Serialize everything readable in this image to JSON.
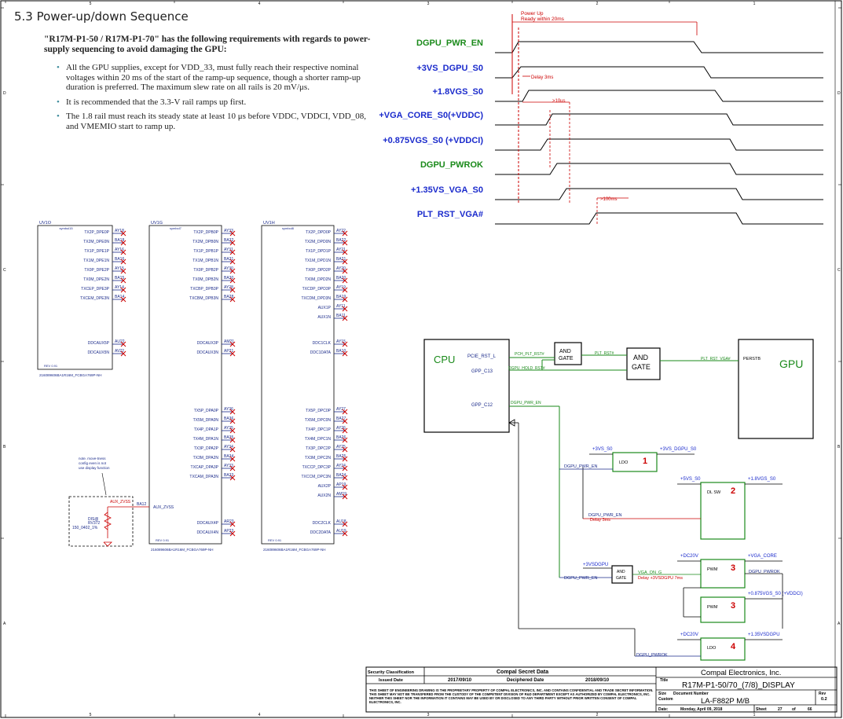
{
  "section": {
    "title": "5.3 Power-up/down Sequence",
    "intro": "\"R17M-P1-50 / R17M-P1-70\" has the following requirements with regards to power-supply sequencing to avoid damaging the GPU:",
    "bullets": [
      "All the GPU supplies, except for VDD_33, must fully reach their respective nominal voltages within 20 ms of the start of the ramp-up sequence, though a shorter ramp-up duration is preferred. The maximum slew rate on all rails is 20 mV/μs.",
      "It is recommended that the 3.3-V rail ramps up first.",
      "The 1.8 rail must reach its steady state at least 10 μs before VDDC, VDDCI, VDD_08, and VMEMIO start to ramp up."
    ]
  },
  "timing": {
    "signals": [
      "DGPU_PWR_EN",
      "+3VS_DGPU_S0",
      "+1.8VGS_S0",
      "+VGA_CORE_S0(+VDDC)",
      "+0.875VGS_S0  (+VDDCI)",
      "DGPU_PWROK",
      "+1.35VS_VGA_S0",
      "PLT_RST_VGA#"
    ],
    "annotations": [
      "Power  Up",
      "Ready  within  20ms",
      "Delay  3ms",
      ">10us",
      ">100ms"
    ]
  },
  "chips": [
    {
      "ref": "UV1O",
      "sub": "symbol15",
      "rev": "REV 0.91",
      "part": "216089606BA1R16M_FCBGA769P-NH",
      "pins": [
        [
          "TX2P_DPE0P",
          "AY18"
        ],
        [
          "TX2M_DPE0N",
          "BA18"
        ],
        [
          "TX1P_DPE1P",
          "AY16"
        ],
        [
          "TX1M_DPE1N",
          "BA16"
        ],
        [
          "TX0P_DPE2P",
          "AY15"
        ],
        [
          "TX0M_DPE2N",
          "BA15"
        ],
        [
          "TXCEP_DPE3P",
          "AY14"
        ],
        [
          "TXCEM_DPE3N",
          "BA14"
        ]
      ],
      "pins2": [
        [
          "DDCAUX5P",
          "AU22"
        ],
        [
          "DDCAUX5N",
          "AV22"
        ]
      ]
    },
    {
      "ref": "UV1G",
      "sub": "symbol7",
      "rev": "REV 0.91",
      "part": "216089606BA1R16M_FCBGA769P-NH",
      "pins": [
        [
          "TX2P_DPB0P",
          "AY33"
        ],
        [
          "TX2M_DPB0N",
          "BA32"
        ],
        [
          "TX1P_DPB1P",
          "AY31"
        ],
        [
          "TX1M_DPB1N",
          "BA31"
        ],
        [
          "TX0P_DPB2P",
          "AY30"
        ],
        [
          "TX0M_DPB2N",
          "BA30"
        ],
        [
          "TXCBP_DPB3P",
          "AY28"
        ],
        [
          "TXCBM_DPB3N",
          "BA28"
        ]
      ],
      "pins_mid": [
        [
          "DDCAUX3P",
          "AM21"
        ],
        [
          "DDCAUX3N",
          "AP21"
        ]
      ],
      "pins2": [
        [
          "TX5P_DPA0P",
          "AY36"
        ],
        [
          "TX5M_DPA0N",
          "BA36"
        ],
        [
          "TX4P_DPA1P",
          "AY35"
        ],
        [
          "TX4M_DPA1N",
          "BA35"
        ],
        [
          "TX3P_DPA2P",
          "AY34"
        ],
        [
          "TX3M_DPA2N",
          "BA34"
        ],
        [
          "TXCAP_DPA3P",
          "AY33"
        ],
        [
          "TXCAM_DPA3N",
          "BA33"
        ]
      ],
      "aux": [
        "AUX_ZVSS",
        "BA12"
      ],
      "pins3": [
        [
          "DDCAUX4P",
          "AR23"
        ],
        [
          "DDCAUX4N",
          "AP23"
        ]
      ]
    },
    {
      "ref": "UV1H",
      "sub": "symbol8",
      "rev": "REV 0.91",
      "part": "216089606BA1R16M_FCBGA769P-NH",
      "pins": [
        [
          "TX2P_DPD0P",
          "AY22"
        ],
        [
          "TX2M_DPD0N",
          "BA22"
        ],
        [
          "TX1P_DPD1P",
          "AY21"
        ],
        [
          "TX1M_DPD1N",
          "BA21"
        ],
        [
          "TX0P_DPD2P",
          "AY20"
        ],
        [
          "TX0M_DPD2N",
          "BA20"
        ],
        [
          "TXCDP_DPD3P",
          "AY19"
        ],
        [
          "TXCDM_DPD3N",
          "BA19"
        ],
        [
          "AUX1P",
          "AY11"
        ],
        [
          "AUX1N",
          "BA11"
        ]
      ],
      "pins_mid": [
        [
          "DDC1CLK",
          "AY15"
        ],
        [
          "DDC1DATA",
          "BA10"
        ]
      ],
      "pins2": [
        [
          "TX5P_DPC0P",
          "AY27"
        ],
        [
          "TX5M_DPC0N",
          "BA27"
        ],
        [
          "TX4P_DPC1P",
          "AY26"
        ],
        [
          "TX4M_DPC1N",
          "BA26"
        ],
        [
          "TX3P_DPC2P",
          "AY25"
        ],
        [
          "TX3M_DPC2N",
          "BA25"
        ],
        [
          "TXCCP_DPC3P",
          "AY24"
        ],
        [
          "TXCCM_DPC3N",
          "BA24"
        ],
        [
          "AUX2P",
          "AP19"
        ],
        [
          "AUX2N",
          "AM19"
        ]
      ],
      "pins3": [
        [
          "DDC2CLK",
          "AU18"
        ],
        [
          "DDC2DATA",
          "AU19"
        ]
      ]
    }
  ],
  "note": {
    "lines": [
      "note. move-tness",
      "config even is not",
      "use display function"
    ],
    "net": "AUX_ZVSS",
    "res_ref": "DIS@",
    "res_name": "RV372",
    "res_val": "150_0402_1%"
  },
  "block": {
    "cpu": "CPU",
    "gpu": "GPU",
    "cpu_pins": [
      "PCIE_RST_L",
      "GPP_C13",
      "GPP_C12"
    ],
    "gpu_pin": "PERSTB",
    "nets": [
      "PCH_PLT_RST#",
      "DGPU_HOLD_RST#",
      "PLT_RST#",
      "PLT_RST_VGA#",
      "DGPU_PWR_EN"
    ],
    "and_gate": "AND\nGATE",
    "regs": [
      {
        "name": "LDO",
        "num": "1",
        "in": "+3VS_S0",
        "out": "+3VS_DGPU_S0",
        "en": "DGPU_PWR_EN"
      },
      {
        "name": "DL SW",
        "num": "2",
        "in": "+5VS_S0",
        "out": "+1.8VGS_S0",
        "en": "DGPU_PWR_EN",
        "note": "Delay  3ms"
      },
      {
        "name": "PWM",
        "num": "3",
        "in": "+DC20V",
        "out": "+VGA_CORE",
        "extra": "DGPU_PWROK"
      },
      {
        "name": "PWM",
        "num": "3",
        "out": "+0.875VGS_S0 (+VDDCI)"
      },
      {
        "name": "LDO",
        "num": "4",
        "in": "+DC20V",
        "out": "+1.35VSDGPU",
        "en": "DGPU_PWROK"
      }
    ],
    "and3": {
      "in1": "+3VSDGPU",
      "in2": "DGPU_PWR_EN",
      "out": "VGA_ON_G",
      "note": "Delay  +3VSDGPU  7ms"
    }
  },
  "titleblock": {
    "security": "Security  Classification",
    "secret": "Compal Secret Data",
    "issued_label": "Issued Date",
    "issued": "2017/09/10",
    "deciphered_label": "Deciphered Date",
    "deciphered": "2018/09/10",
    "company": "Compal Electronics, Inc.",
    "title_label": "Title",
    "title": "R17M-P1-50/70_(7/8)_DISPLAY",
    "size_label": "Size",
    "size": "Custom",
    "docnum_label": "Document Number",
    "docnum": "LA-F882P M/B",
    "rev_label": "Rev",
    "rev": "0.2",
    "date_label": "Date:",
    "date": "Monday, April 09, 2018",
    "sheet_label": "Sheet",
    "sheet": "27",
    "of_label": "of",
    "of": "66",
    "disclaimer": "THIS SHEET OF ENGINEERING DRAWING IS THE PROPRIETARY PROPERTY OF COMPAL ELECTRONICS, INC. AND CONTAINS CONFIDENTIAL AND TRADE SECRET INFORMATION. THIS SHEET MAY NOT BE TRANSFERED FROM THE CUSTODY OF THE COMPETENT DIVISION OF R&D DEPARTMENT EXCEPT AS AUTHORIZED BY COMPAL ELECTRONICS, INC. NEITHER THIS SHEET NOR THE INFORMATION IT CONTAINS MAY BE USED BY OR DISCLOSED TO ANY THIRD PARTY WITHOUT PRIOR WRITTEN CONSENT OF COMPAL ELECTRONICS, INC."
  },
  "grid": {
    "cols": [
      "5",
      "4",
      "3",
      "2",
      "1"
    ],
    "rows": [
      "D",
      "C",
      "B",
      "A"
    ]
  },
  "colors": {
    "green": "#1a8a1a",
    "blue": "#1a2acc",
    "red": "#cc0000",
    "navy": "#1a2a8a"
  }
}
